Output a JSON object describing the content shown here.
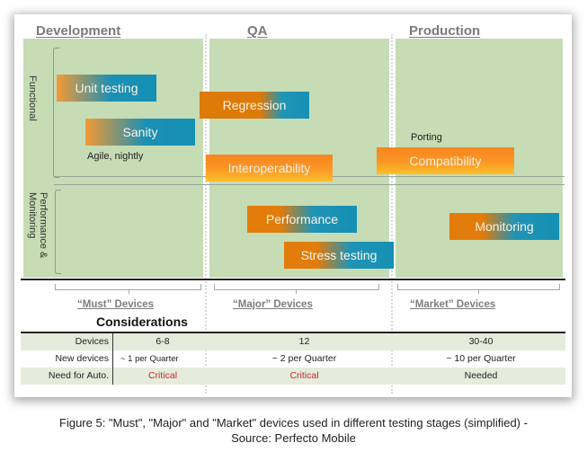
{
  "stages": {
    "development": "Development",
    "qa": "QA",
    "production": "Production"
  },
  "axes": {
    "functional": "Functional",
    "performance_monitoring": "Performance & Monitoring"
  },
  "activities": {
    "unit_testing": "Unit testing",
    "sanity": "Sanity",
    "regression": "Regression",
    "interoperability": "Interoperability",
    "compatibility": "Compatibility",
    "performance": "Performance",
    "stress_testing": "Stress testing",
    "monitoring": "Monitoring"
  },
  "notes": {
    "agile_nightly": "Agile, nightly",
    "porting": "Porting"
  },
  "device_groups": {
    "must": "“Must” Devices",
    "major": "“Major” Devices",
    "market": "“Market” Devices"
  },
  "considerations_title": "Considerations",
  "table": {
    "rows": [
      {
        "label": "Devices",
        "must": "6-8",
        "major": "12",
        "market": "30-40"
      },
      {
        "label": "New devices",
        "must": "~ 1 per Quarter",
        "major": "~ 2 per Quarter",
        "market": "~ 10 per Quarter"
      },
      {
        "label": "Need for Auto.",
        "must": "Critical",
        "major": "Critical",
        "market": "Needed"
      }
    ]
  },
  "caption": {
    "line1": "Figure 5: \"Must\", \"Major\" and \"Market\" devices used in different testing stages (simplified) -",
    "line2": "Source: Perfecto Mobile"
  },
  "colors": {
    "panel_green": "#c6dcb4",
    "orange": "#e27c0a",
    "teal": "#1590b5",
    "critical_red": "#c8282a"
  }
}
